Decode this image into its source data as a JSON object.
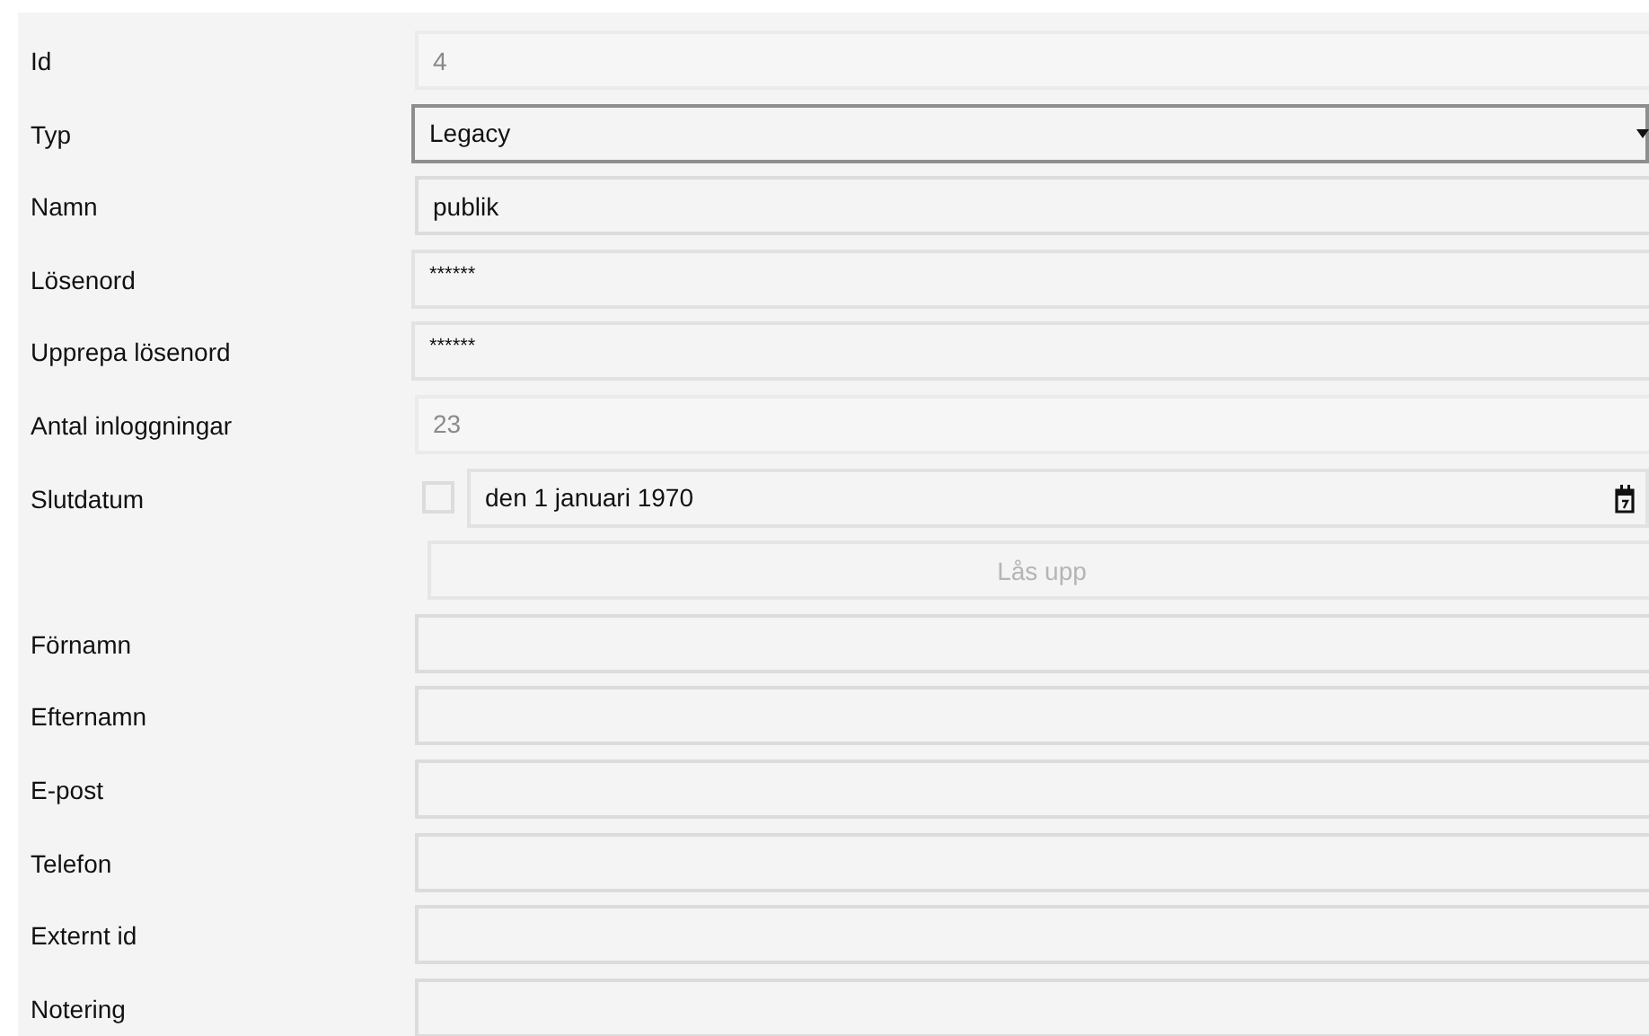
{
  "rows": [
    {
      "label": "Id",
      "kind": "text",
      "value": "4",
      "readonly": true
    },
    {
      "label": "Typ",
      "kind": "dropdown",
      "value": "Legacy"
    },
    {
      "label": "Namn",
      "kind": "text",
      "value": "publik",
      "readonly": false
    },
    {
      "label": "Lösenord",
      "kind": "password",
      "value": "******"
    },
    {
      "label": "Upprepa lösenord",
      "kind": "password",
      "value": "******"
    },
    {
      "label": "Antal inloggningar",
      "kind": "text",
      "value": "23",
      "readonly": true
    },
    {
      "label": "Slutdatum",
      "kind": "date",
      "checked": false,
      "value": "den 1 januari 1970"
    },
    {
      "kind": "button",
      "text": "Lås upp",
      "disabled": true
    },
    {
      "label": "Förnamn",
      "kind": "text",
      "readonly": false
    },
    {
      "label": "Efternamn",
      "kind": "text",
      "readonly": false
    },
    {
      "label": "E-post",
      "kind": "text",
      "readonly": false
    },
    {
      "label": "Telefon",
      "kind": "text",
      "readonly": false
    },
    {
      "label": "Externt id",
      "kind": "text",
      "readonly": false
    },
    {
      "label": "Notering",
      "kind": "text",
      "readonly": false
    }
  ]
}
